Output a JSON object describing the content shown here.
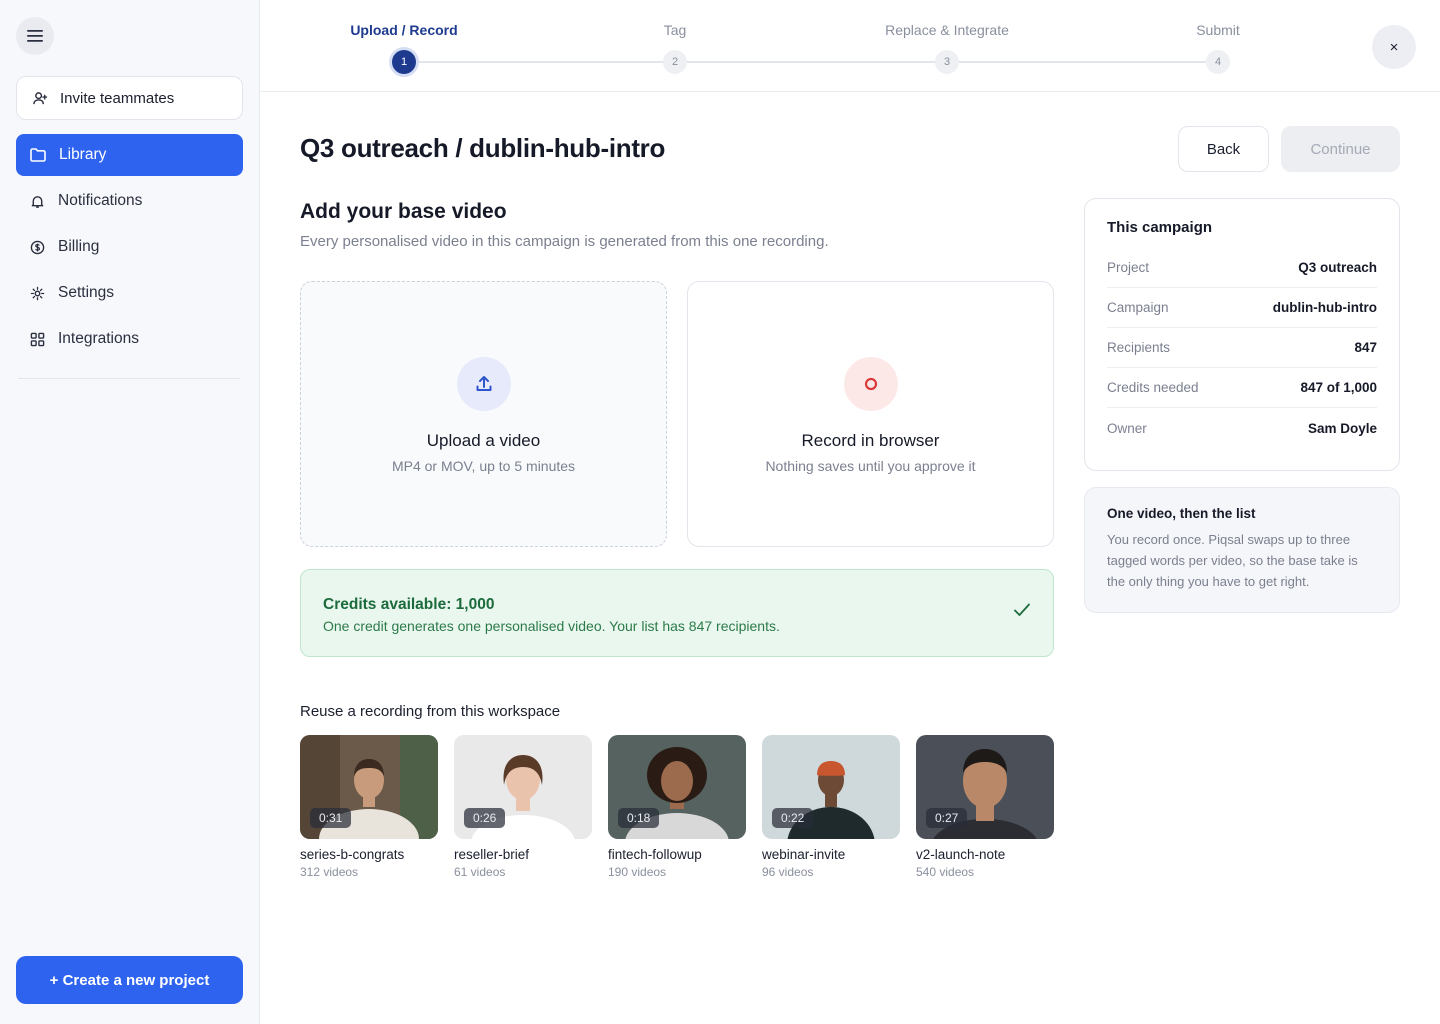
{
  "sidebar": {
    "invite_label": "Invite teammates",
    "items": [
      {
        "label": "Library",
        "icon": "folder-icon",
        "active": true
      },
      {
        "label": "Notifications",
        "icon": "bell-icon",
        "active": false
      },
      {
        "label": "Billing",
        "icon": "dollar-icon",
        "active": false
      },
      {
        "label": "Settings",
        "icon": "gear-icon",
        "active": false
      },
      {
        "label": "Integrations",
        "icon": "grid-icon",
        "active": false
      }
    ],
    "create_label": "+ Create a new project"
  },
  "stepper": {
    "steps": [
      {
        "label": "Upload / Record",
        "number": "1"
      },
      {
        "label": "Tag",
        "number": "2"
      },
      {
        "label": "Replace & Integrate",
        "number": "3"
      },
      {
        "label": "Submit",
        "number": "4"
      }
    ],
    "current_step": 1,
    "close_label": "×"
  },
  "header": {
    "title": "Q3 outreach / dublin-hub-intro",
    "back_label": "Back",
    "continue_label": "Continue"
  },
  "base_video": {
    "title": "Add your base video",
    "subtitle": "Every personalised video in this campaign is generated from this one recording.",
    "upload": {
      "title": "Upload a video",
      "subtitle": "MP4 or MOV, up to 5 minutes"
    },
    "record": {
      "title": "Record in browser",
      "subtitle": "Nothing saves until you approve it"
    }
  },
  "credits": {
    "title": "Credits available: 1,000",
    "subtitle": "One credit generates one personalised video. Your list has 847 recipients."
  },
  "reuse": {
    "title": "Reuse a recording from this workspace",
    "items": [
      {
        "name": "series-b-congrats",
        "count": "312 videos",
        "duration": "0:31",
        "bg": "#6b5a4a",
        "skin": "#c89b7c",
        "hair": "#3a2a1f",
        "shirt": "#e8e4dc"
      },
      {
        "name": "reseller-brief",
        "count": "61 videos",
        "duration": "0:26",
        "bg": "#e9e9ea",
        "skin": "#e9c3ac",
        "hair": "#5a3b28",
        "shirt": "#ffffff"
      },
      {
        "name": "fintech-followup",
        "count": "190 videos",
        "duration": "0:18",
        "bg": "#55625f",
        "skin": "#9c6b4e",
        "hair": "#2a1c15",
        "shirt": "#d8d8d8"
      },
      {
        "name": "webinar-invite",
        "count": "96 videos",
        "duration": "0:22",
        "bg": "#cfd8db",
        "skin": "#6d4a36",
        "hair": "#c8562e",
        "shirt": "#1f2a2c"
      },
      {
        "name": "v2-launch-note",
        "count": "540 videos",
        "duration": "0:27",
        "bg": "#4b4f57",
        "skin": "#b98868",
        "hair": "#1e1a18",
        "shirt": "#2b2d33"
      }
    ]
  },
  "campaign": {
    "title": "This campaign",
    "rows": [
      {
        "key": "Project",
        "value": "Q3 outreach"
      },
      {
        "key": "Campaign",
        "value": "dublin-hub-intro"
      },
      {
        "key": "Recipients",
        "value": "847"
      },
      {
        "key": "Credits needed",
        "value": "847 of 1,000"
      },
      {
        "key": "Owner",
        "value": "Sam Doyle"
      }
    ]
  },
  "info": {
    "title": "One video, then the list",
    "body": "You record once. Piqsal swaps up to three tagged words per video, so the base take is the only thing you have to get right."
  },
  "colors": {
    "accent": "#2e63f0",
    "step_active": "#1d3a8f",
    "success": "#1c6b3c",
    "record_red": "#d93a3a"
  }
}
